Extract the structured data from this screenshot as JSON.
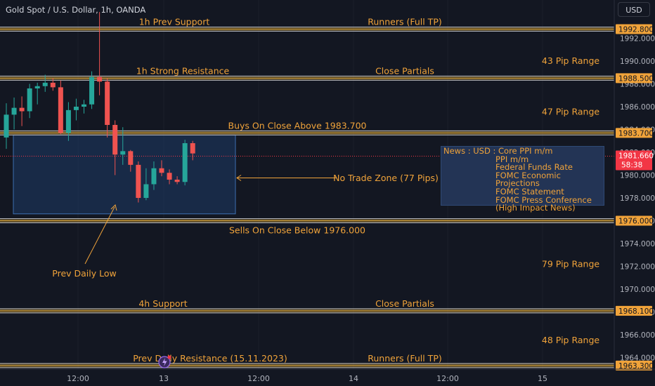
{
  "header": {
    "symbol_title": "Gold Spot / U.S. Dollar, 1h, OANDA",
    "currency_button": "USD"
  },
  "theme": {
    "background": "#131722",
    "level_line": "#b0b4be",
    "level_line_band": "#d7a338",
    "annotation_text": "#f0a33a",
    "up_candle": "#26a69a",
    "down_candle": "#ef5350",
    "zone_fill": "#1e3a66",
    "zone_border": "#3c6fb0",
    "price_tag_bg": "#f0a33a",
    "current_price_bg": "#f23645",
    "axis_text": "#b2b5be"
  },
  "chart_data": {
    "type": "candlestick",
    "symbol": "Gold Spot / U.S. Dollar",
    "timeframe": "1h",
    "source": "OANDA",
    "y_axis": {
      "ticks": [
        "1992.000",
        "1990.000",
        "1988.000",
        "1986.000",
        "1984.000",
        "1982.000",
        "1980.000",
        "1978.000",
        "1976.000",
        "1974.000",
        "1972.000",
        "1970.000",
        "1968.000",
        "1966.000",
        "1964.000"
      ],
      "ylim": [
        1963.0,
        1994.5
      ]
    },
    "x_axis": {
      "ticks": [
        "12:00",
        "13",
        "12:00",
        "14",
        "12:00",
        "15"
      ]
    },
    "candles": [
      {
        "o": 1983.3,
        "h": 1986.3,
        "l": 1982.3,
        "c": 1985.3
      },
      {
        "o": 1985.3,
        "h": 1986.8,
        "l": 1984.0,
        "c": 1985.9
      },
      {
        "o": 1985.9,
        "h": 1986.9,
        "l": 1984.3,
        "c": 1985.6
      },
      {
        "o": 1985.6,
        "h": 1988.0,
        "l": 1985.0,
        "c": 1987.6
      },
      {
        "o": 1987.6,
        "h": 1988.1,
        "l": 1986.2,
        "c": 1987.8
      },
      {
        "o": 1987.8,
        "h": 1988.8,
        "l": 1987.3,
        "c": 1988.1
      },
      {
        "o": 1988.1,
        "h": 1988.5,
        "l": 1987.4,
        "c": 1987.7
      },
      {
        "o": 1987.7,
        "h": 1988.3,
        "l": 1983.6,
        "c": 1983.7
      },
      {
        "o": 1983.7,
        "h": 1986.4,
        "l": 1983.0,
        "c": 1985.7
      },
      {
        "o": 1985.7,
        "h": 1986.7,
        "l": 1984.8,
        "c": 1986.0
      },
      {
        "o": 1986.0,
        "h": 1986.6,
        "l": 1985.4,
        "c": 1986.2
      },
      {
        "o": 1986.2,
        "h": 1989.1,
        "l": 1985.8,
        "c": 1988.6
      },
      {
        "o": 1988.6,
        "h": 1994.3,
        "l": 1987.0,
        "c": 1988.2
      },
      {
        "o": 1988.2,
        "h": 1988.5,
        "l": 1983.3,
        "c": 1984.4
      },
      {
        "o": 1984.4,
        "h": 1984.8,
        "l": 1980.0,
        "c": 1981.8
      },
      {
        "o": 1981.8,
        "h": 1984.2,
        "l": 1980.9,
        "c": 1982.1
      },
      {
        "o": 1982.1,
        "h": 1982.2,
        "l": 1980.3,
        "c": 1980.9
      },
      {
        "o": 1980.9,
        "h": 1981.2,
        "l": 1977.6,
        "c": 1978.0
      },
      {
        "o": 1978.0,
        "h": 1980.6,
        "l": 1977.8,
        "c": 1979.2
      },
      {
        "o": 1979.2,
        "h": 1981.2,
        "l": 1978.7,
        "c": 1980.6
      },
      {
        "o": 1980.6,
        "h": 1981.3,
        "l": 1979.9,
        "c": 1980.2
      },
      {
        "o": 1980.2,
        "h": 1980.5,
        "l": 1979.2,
        "c": 1979.6
      },
      {
        "o": 1979.6,
        "h": 1979.9,
        "l": 1979.2,
        "c": 1979.4
      },
      {
        "o": 1979.4,
        "h": 1983.1,
        "l": 1979.1,
        "c": 1982.8
      },
      {
        "o": 1982.8,
        "h": 1983.0,
        "l": 1981.3,
        "c": 1981.9
      }
    ],
    "current_price": {
      "value": "1981.660",
      "countdown": "58:38",
      "level": 1981.66
    },
    "levels": [
      {
        "price": 1992.8,
        "tag": "1992.800"
      },
      {
        "price": 1988.5,
        "tag": "1988.500"
      },
      {
        "price": 1983.7,
        "tag": "1983.700"
      },
      {
        "price": 1976.0,
        "tag": "1976.000"
      },
      {
        "price": 1968.1,
        "tag": "1968.100"
      },
      {
        "price": 1963.3,
        "tag": "1963.300"
      }
    ],
    "no_trade_zone": {
      "top": 1983.7,
      "bottom": 1976.6,
      "label": "No Trade Zone (77 Pips)"
    },
    "annotations": [
      {
        "text": "1h Prev Support",
        "price": 1992.8
      },
      {
        "text": "Runners (Full TP)",
        "price": 1992.8
      },
      {
        "text": "1h Strong Resistance",
        "price": 1988.5
      },
      {
        "text": "Close Partials",
        "price": 1988.5
      },
      {
        "text": "Buys On Close Above 1983.700",
        "price": 1983.7
      },
      {
        "text": "Sells On Close Below 1976.000",
        "price": 1976.0
      },
      {
        "text": "4h Support",
        "price": 1968.1
      },
      {
        "text": "Close Partials",
        "price": 1968.1
      },
      {
        "text": "Prev Daily Resistance (15.11.2023)",
        "price": 1963.3
      },
      {
        "text": "Runners (Full TP)",
        "price": 1963.3
      }
    ],
    "pip_ranges": [
      "43 Pip Range",
      "47 Pip Range",
      "79 Pip Range",
      "48 Pip Range"
    ],
    "prev_daily_low_label": "Prev Daily Low"
  },
  "news_box": {
    "first_line": "News : USD : Core PPI m/m",
    "items": [
      "PPI m/m",
      "Federal Funds Rate",
      "FOMC Economic Projections",
      "FOMC Statement",
      "FOMC Press Conference",
      "(High Impact News)"
    ]
  },
  "event_marker_icon": "lightning-icon"
}
